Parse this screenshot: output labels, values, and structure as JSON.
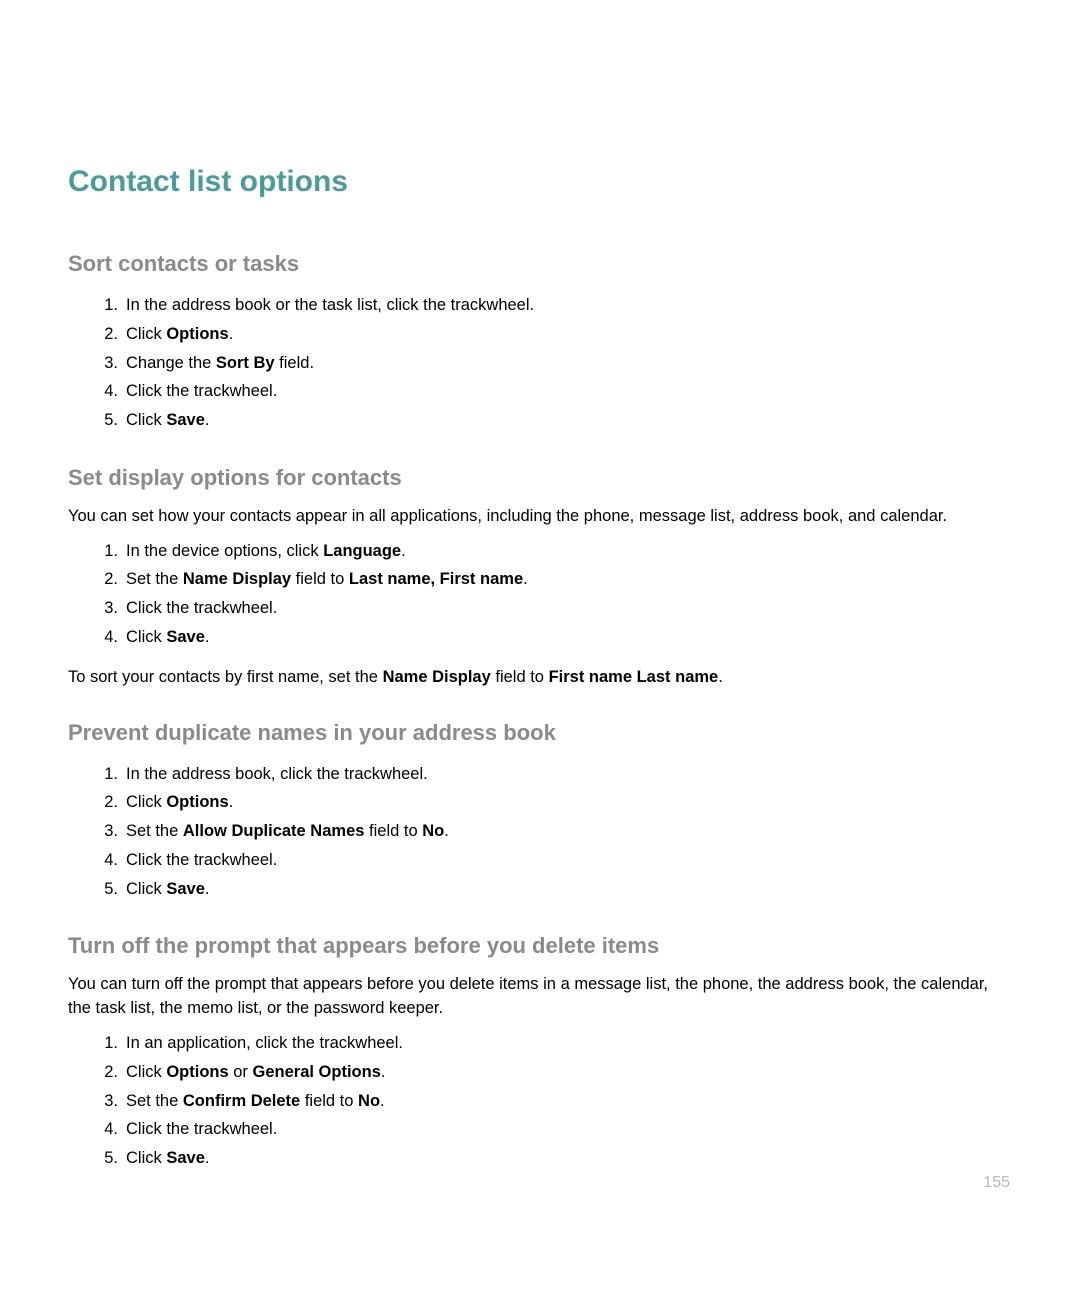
{
  "title": "Contact list options",
  "sections": [
    {
      "heading": "Sort contacts or tasks",
      "steps": [
        {
          "pre": "In the address book or the task list, click the trackwheel."
        },
        {
          "pre": "Click ",
          "b1": "Options",
          "post": "."
        },
        {
          "pre": "Change the ",
          "b1": "Sort By",
          "post": " field."
        },
        {
          "pre": "Click the trackwheel."
        },
        {
          "pre": "Click ",
          "b1": "Save",
          "post": "."
        }
      ]
    },
    {
      "heading": "Set display options for contacts",
      "intro": "You can set how your contacts appear in all applications, including the phone, message list, address book, and calendar.",
      "steps": [
        {
          "pre": "In the device options, click ",
          "b1": "Language",
          "post": "."
        },
        {
          "pre": "Set the ",
          "b1": "Name Display",
          "mid1": " field to ",
          "b2": "Last name, First name",
          "post": "."
        },
        {
          "pre": "Click the trackwheel."
        },
        {
          "pre": "Click ",
          "b1": "Save",
          "post": "."
        }
      ],
      "outro": {
        "pre": "To sort your contacts by first name, set the ",
        "b1": "Name Display",
        "mid1": " field to ",
        "b2": "First name Last name",
        "post": "."
      }
    },
    {
      "heading": "Prevent duplicate names in your address book",
      "steps": [
        {
          "pre": "In the address book, click the trackwheel."
        },
        {
          "pre": "Click ",
          "b1": "Options",
          "post": "."
        },
        {
          "pre": "Set the ",
          "b1": "Allow Duplicate Names",
          "mid1": " field to ",
          "b2": "No",
          "post": "."
        },
        {
          "pre": "Click the trackwheel."
        },
        {
          "pre": "Click ",
          "b1": "Save",
          "post": "."
        }
      ]
    },
    {
      "heading": "Turn off the prompt that appears before you delete items",
      "intro": "You can turn off the prompt that appears before you delete items in a message list, the phone, the address book, the calendar, the task list, the memo list, or the password keeper.",
      "steps": [
        {
          "pre": "In an application, click the trackwheel."
        },
        {
          "pre": "Click ",
          "b1": "Options",
          "mid1": " or ",
          "b2": "General Options",
          "post": "."
        },
        {
          "pre": "Set the ",
          "b1": "Confirm Delete",
          "mid1": " field to ",
          "b2": "No",
          "post": "."
        },
        {
          "pre": "Click the trackwheel."
        },
        {
          "pre": "Click ",
          "b1": "Save",
          "post": "."
        }
      ]
    }
  ],
  "page_number": "155"
}
